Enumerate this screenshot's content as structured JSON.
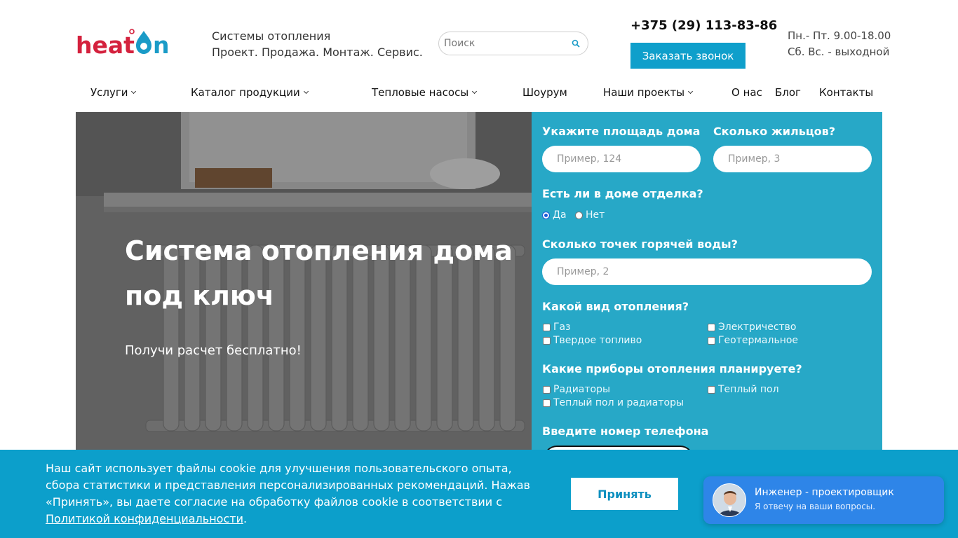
{
  "header": {
    "logo_text": "heat On",
    "tagline_line1": "Системы отопления",
    "tagline_line2": "Проект. Продажа. Монтаж. Сервис.",
    "search_placeholder": "Поиск",
    "phone": "+375 (29) 113-83-86",
    "callback_label": "Заказать звонок",
    "hours_line1": "Пн.- Пт. 9.00-18.00",
    "hours_line2": "Сб. Вс. - выходной"
  },
  "nav": {
    "items": [
      {
        "label": "Услуги",
        "dropdown": true
      },
      {
        "label": "Каталог продукции",
        "dropdown": true
      },
      {
        "label": "Тепловые насосы",
        "dropdown": true
      },
      {
        "label": "Шоурум",
        "dropdown": false
      },
      {
        "label": "Наши проекты",
        "dropdown": true
      },
      {
        "label": "О нас",
        "dropdown": false
      },
      {
        "label": "Блог",
        "dropdown": false
      },
      {
        "label": "Контакты",
        "dropdown": false
      }
    ]
  },
  "hero": {
    "title": "Система отопления дома под ключ",
    "subtitle": "Получи расчет бесплатно!"
  },
  "form": {
    "area_label": "Укажите площадь дома",
    "area_placeholder": "Пример, 124",
    "residents_label": "Сколько жильцов?",
    "residents_placeholder": "Пример, 3",
    "finish_label": "Есть ли в доме отделка?",
    "finish_options": [
      "Да",
      "Нет"
    ],
    "finish_selected": "Да",
    "hotwater_label": "Сколько точек горячей воды?",
    "hotwater_placeholder": "Пример, 2",
    "heating_type_label": "Какой вид отопления?",
    "heating_types": [
      "Газ",
      "Электричество",
      "Твердое топливо",
      "Геотермальное"
    ],
    "devices_label": "Какие приборы отопления планируете?",
    "devices": [
      "Радиаторы",
      "Теплый пол",
      "Теплый пол и радиаторы"
    ],
    "phone_label": "Введите номер телефона"
  },
  "cookie": {
    "text": "Наш сайт использует файлы cookie для улучшения пользовательского опыта, сбора статистики и представления персонализированных рекомендаций. Нажав «Принять», вы даете согласие на обработку файлов cookie в соответствии с ",
    "link_text": "Политикой конфиденциальности",
    "text_end": ".",
    "accept_label": "Принять"
  },
  "chat": {
    "name": "Инженер - проектировщик",
    "message": "Я отвечу на ваши вопросы."
  },
  "colors": {
    "brand_red": "#d4213d",
    "brand_blue": "#1a9bc7",
    "accent": "#0f9fcb",
    "form_bg": "#27a8c7",
    "chat_bg": "#2e85e8"
  }
}
